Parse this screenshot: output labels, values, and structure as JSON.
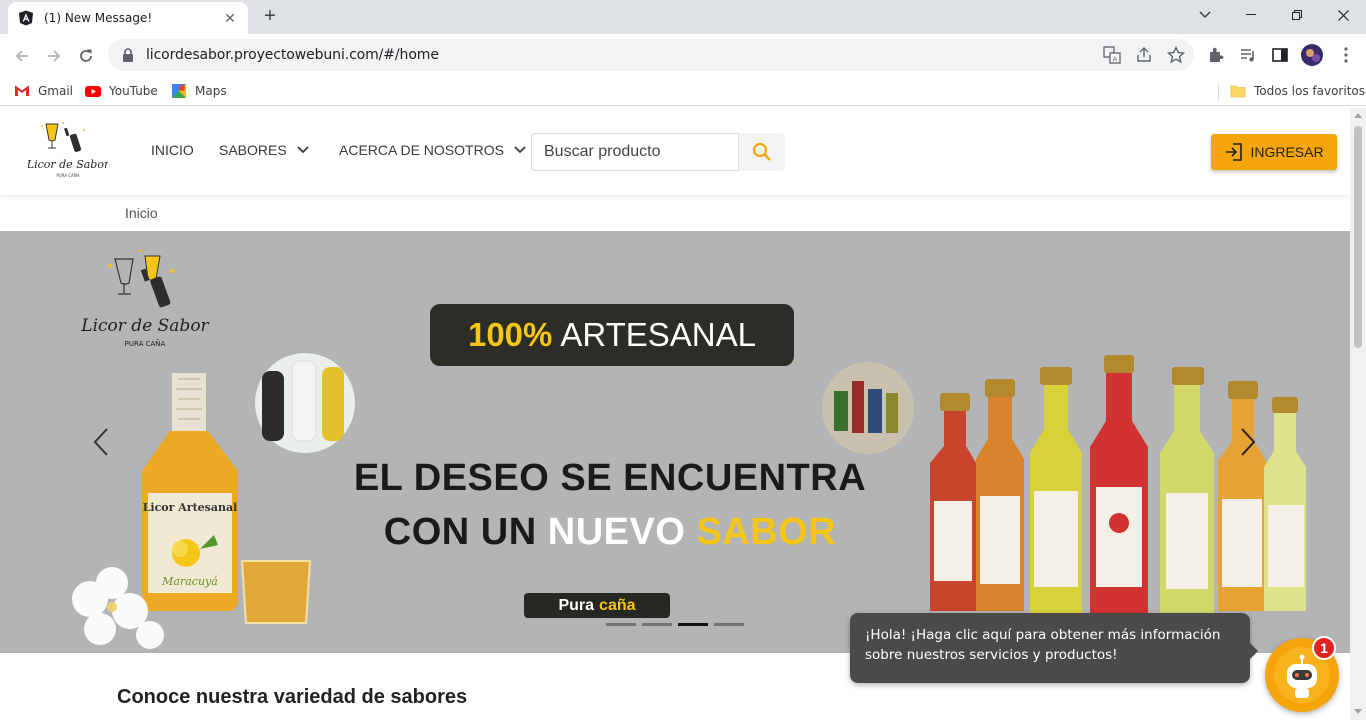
{
  "browser": {
    "tab_title": "(1) New Message!",
    "url": "licordesabor.proyectowebuni.com/#/home",
    "bookmarks": [
      {
        "label": "Gmail",
        "icon": "gmail-icon"
      },
      {
        "label": "YouTube",
        "icon": "youtube-icon"
      },
      {
        "label": "Maps",
        "icon": "maps-icon"
      }
    ],
    "favorites_label": "Todos los favoritos"
  },
  "header": {
    "nav": [
      {
        "label": "INICIO"
      },
      {
        "label": "SABORES"
      },
      {
        "label": "ACERCA DE NOSOTROS"
      }
    ],
    "search_placeholder": "Buscar producto",
    "login_label": "INGRESAR"
  },
  "breadcrumb": "Inicio",
  "hero": {
    "badge_highlight": "100%",
    "badge_text": "ARTESANAL",
    "line1": "EL DESEO SE ENCUENTRA",
    "line2_a": "CON UN",
    "line2_b": "NUEVO",
    "line2_c": "SABOR",
    "tag_a": "Pura",
    "tag_b": "caña",
    "logo_text": "Licor de Sabor",
    "logo_sub": "PURA CAÑA",
    "bottle_label": "Licor Artesanal",
    "bottle_flavor": "Maracuyá",
    "slides_count": 4,
    "active_slide": 3
  },
  "section_title": "Conoce nuestra variedad de sabores",
  "chat": {
    "message": "¡Hola! ¡Haga clic aquí para obtener más información sobre nuestros servicios y productos!",
    "badge": "1"
  },
  "colors": {
    "accent": "#f5a50a",
    "gold": "#f5c518",
    "hero_bg": "#b2b4b6"
  }
}
